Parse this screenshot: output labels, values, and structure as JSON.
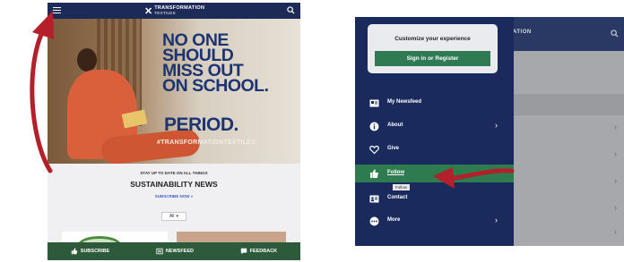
{
  "left_screen": {
    "logo_top": "TRANSFORMATION",
    "logo_bottom": "TEXTILES",
    "hero": {
      "headline_lines": [
        "NO ONE",
        "SHOULD",
        "MISS OUT",
        "ON SCHOOL."
      ],
      "period": "PERIOD.",
      "hashtag": "#TRANSFORMATIONTEXTILES"
    },
    "news": {
      "kicker": "STAY UP TO DATE ON ALL THINGS",
      "heading": "SUSTAINABILITY NEWS",
      "subscribe_link": "SUBSCRIBE NOW »",
      "filter_value": "All"
    },
    "bottom_nav": [
      {
        "label": "SUBSCRIBE",
        "icon": "thumbs-up-icon"
      },
      {
        "label": "NEWSFEED",
        "icon": "newspaper-icon"
      },
      {
        "label": "FEEDBACK",
        "icon": "chat-bubble-icon"
      }
    ]
  },
  "right_screen": {
    "header_title_partial": "ATION",
    "customize": {
      "title": "Customize your experience",
      "button": "Sign in or Register"
    },
    "menu": [
      {
        "label": "My Newsfeed",
        "icon": "newsfeed-icon",
        "chevron": false
      },
      {
        "label": "About",
        "icon": "info-icon",
        "chevron": true
      },
      {
        "label": "Give",
        "icon": "heart-icon",
        "chevron": false
      },
      {
        "label": "Follow",
        "icon": "follow-icon",
        "chevron": false,
        "active": true
      },
      {
        "label": "Contact",
        "icon": "contact-card-icon",
        "chevron": false
      },
      {
        "label": "More",
        "icon": "more-icon",
        "chevron": true
      }
    ],
    "follow_tooltip": "Follow"
  },
  "colors": {
    "navy": "#1b2a57",
    "green": "#2e5a3c",
    "accent_green": "#2d7b4f",
    "arrow_red": "#b3202a"
  }
}
